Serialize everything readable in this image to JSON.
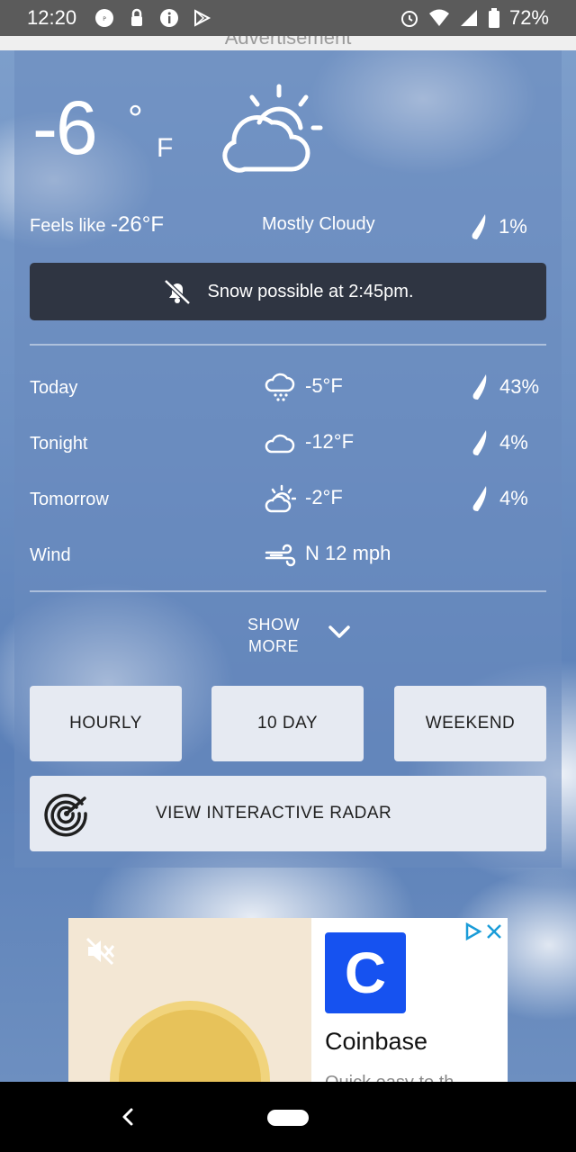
{
  "status_bar": {
    "time": "12:20",
    "battery": "72%"
  },
  "ad_label": "Advertisement",
  "current": {
    "temp": "-6",
    "degree": "°",
    "unit": "F",
    "feels_label": "Feels like",
    "feels_value": "-26°F",
    "condition": "Mostly Cloudy",
    "precip": "1%",
    "icon": "partly-cloudy-icon"
  },
  "alert": {
    "text": "Snow possible at 2:45pm.",
    "icon": "notifications-off-icon"
  },
  "forecast": [
    {
      "label": "Today",
      "icon": "snow-cloud-icon",
      "value": "-5°F",
      "precip": "43%"
    },
    {
      "label": "Tonight",
      "icon": "cloud-icon",
      "value": "-12°F",
      "precip": "4%"
    },
    {
      "label": "Tomorrow",
      "icon": "partly-cloudy-icon",
      "value": "-2°F",
      "precip": "4%"
    }
  ],
  "wind": {
    "label": "Wind",
    "value": "N 12 mph",
    "icon": "wind-icon"
  },
  "show_more": {
    "line1": "SHOW",
    "line2": "MORE"
  },
  "buttons": {
    "hourly": "HOURLY",
    "ten_day": "10 DAY",
    "weekend": "WEEKEND",
    "radar": "VIEW INTERACTIVE RADAR"
  },
  "ad": {
    "brand": "Coinbase",
    "logo_letter": "C",
    "sub": "Quick easy to th"
  },
  "colors": {
    "alert_bg": "#2f3542",
    "button_bg": "#e6eaf2",
    "coinbase_blue": "#1652f0"
  }
}
